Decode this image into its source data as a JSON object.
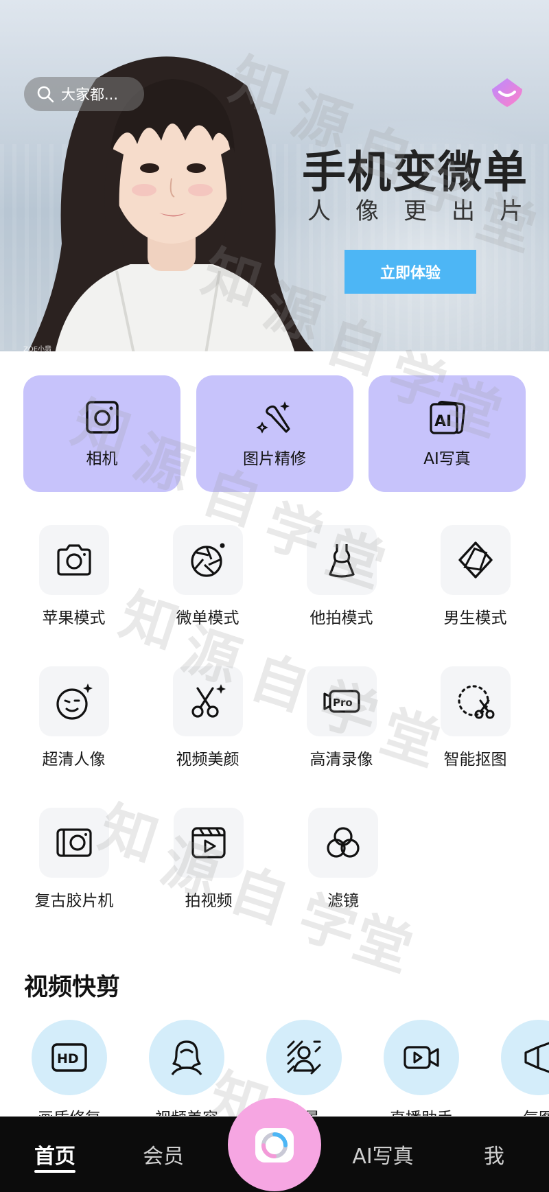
{
  "banner": {
    "search_placeholder": "大家都...",
    "promo_title": "手机变微单",
    "promo_sub_chars": [
      "人",
      "像",
      "更",
      "出",
      "片"
    ],
    "cta_label": "立即体验",
    "photo_credit": "ZOE小翡",
    "cta_color": "#4db6f5"
  },
  "feature_cards": [
    {
      "label": "相机",
      "icon": "camera-icon"
    },
    {
      "label": "图片精修",
      "icon": "magic-wand-icon"
    },
    {
      "label": "AI写真",
      "icon": "ai-portrait-icon"
    }
  ],
  "tools": [
    {
      "label": "苹果模式",
      "icon": "apple-camera-icon"
    },
    {
      "label": "微单模式",
      "icon": "aperture-icon"
    },
    {
      "label": "他拍模式",
      "icon": "dress-icon"
    },
    {
      "label": "男生模式",
      "icon": "diamond-icon"
    },
    {
      "label": "超清人像",
      "icon": "face-sparkle-icon"
    },
    {
      "label": "视频美颜",
      "icon": "scissors-sparkle-icon"
    },
    {
      "label": "高清录像",
      "icon": "pro-video-icon"
    },
    {
      "label": "智能抠图",
      "icon": "cutout-icon"
    },
    {
      "label": "复古胶片机",
      "icon": "retro-camera-icon"
    },
    {
      "label": "拍视频",
      "icon": "video-clapper-icon"
    },
    {
      "label": "滤镜",
      "icon": "filter-circles-icon"
    }
  ],
  "section": {
    "title": "视频快剪",
    "items": [
      {
        "label": "画质修复",
        "icon": "hd-icon"
      },
      {
        "label": "视频美容",
        "icon": "portrait-outline-icon"
      },
      {
        "label": "背景",
        "icon": "background-person-icon"
      },
      {
        "label": "直播助手",
        "icon": "video-camera-icon"
      },
      {
        "label": "气图",
        "icon": "megaphone-icon"
      }
    ]
  },
  "watermark_text": "知源自学堂",
  "nav": {
    "home": "首页",
    "vip": "会员",
    "ai": "AI写真",
    "me": "我"
  },
  "colors": {
    "card_purple": "#c7c3fb",
    "quick_blue": "#d4edfa",
    "fab_pink": "#f6a6e2",
    "nav_bg": "#0c0c0c"
  }
}
